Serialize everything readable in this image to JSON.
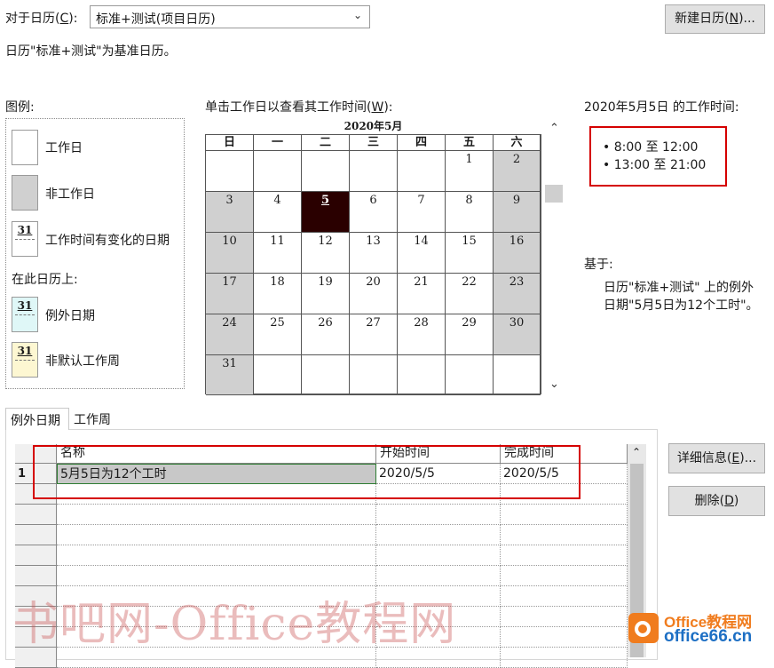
{
  "for_calendar_label": "对于日历(",
  "for_calendar_key": "C",
  "for_calendar_suffix": "):",
  "calendar_select_value": "标准+测试(项目日历)",
  "new_calendar_button": {
    "prefix": "新建日历(",
    "key": "N",
    "suffix": ")..."
  },
  "base_calendar_note": "日历\"标准+测试\"为基准日历。",
  "legend": {
    "title": "图例:",
    "items": [
      {
        "label": "工作日"
      },
      {
        "label": "非工作日"
      },
      {
        "label": "工作时间有变化的日期",
        "num": "31"
      }
    ],
    "on_this_calendar": "在此日历上:",
    "items2": [
      {
        "label": "例外日期",
        "num": "31",
        "color": "#dff7f7"
      },
      {
        "label": "非默认工作周",
        "num": "31",
        "color": "#fdf7d2"
      }
    ]
  },
  "calendar": {
    "instruction_prefix": "单击工作日以查看其工作时间(",
    "instruction_key": "W",
    "instruction_suffix": "):",
    "month_title": "2020年5月",
    "weekdays": [
      "日",
      "一",
      "二",
      "三",
      "四",
      "五",
      "六"
    ],
    "weeks": [
      [
        "",
        "",
        "",
        "",
        "",
        "1",
        "2"
      ],
      [
        "3",
        "4",
        "5",
        "6",
        "7",
        "8",
        "9"
      ],
      [
        "10",
        "11",
        "12",
        "13",
        "14",
        "15",
        "16"
      ],
      [
        "17",
        "18",
        "19",
        "20",
        "21",
        "22",
        "23"
      ],
      [
        "24",
        "25",
        "26",
        "27",
        "28",
        "29",
        "30"
      ],
      [
        "31",
        "",
        "",
        "",
        "",
        "",
        ""
      ]
    ],
    "selected_day": "5",
    "colors": {
      "nonworking": "#d0d0d0",
      "selected": "#2a0000"
    }
  },
  "working_times": {
    "title": "2020年5月5日 的工作时间:",
    "items": [
      "• 8:00 至 12:00",
      "• 13:00 至 21:00"
    ]
  },
  "based_on": {
    "label": "基于:",
    "line1": "日历\"标准+测试\" 上的例外",
    "line2": "日期\"5月5日为12个工时\"。"
  },
  "tabs": [
    {
      "label": "例外日期",
      "active": true
    },
    {
      "label": "工作周",
      "active": false
    }
  ],
  "exceptions_table": {
    "headers": [
      "名称",
      "开始时间",
      "完成时间"
    ],
    "rows": [
      {
        "num": "1",
        "name": "5月5日为12个工时",
        "start": "2020/5/5",
        "finish": "2020/5/5"
      }
    ]
  },
  "details_button": {
    "prefix": "详细信息(",
    "key": "E",
    "suffix": ")..."
  },
  "delete_button": {
    "prefix": "删除(",
    "key": "D",
    "suffix": ")"
  },
  "watermark": "书吧网-Office教程网",
  "logo": {
    "line1": "Office教程网",
    "line2": "office66.cn"
  },
  "highlight_color": "#d50000"
}
